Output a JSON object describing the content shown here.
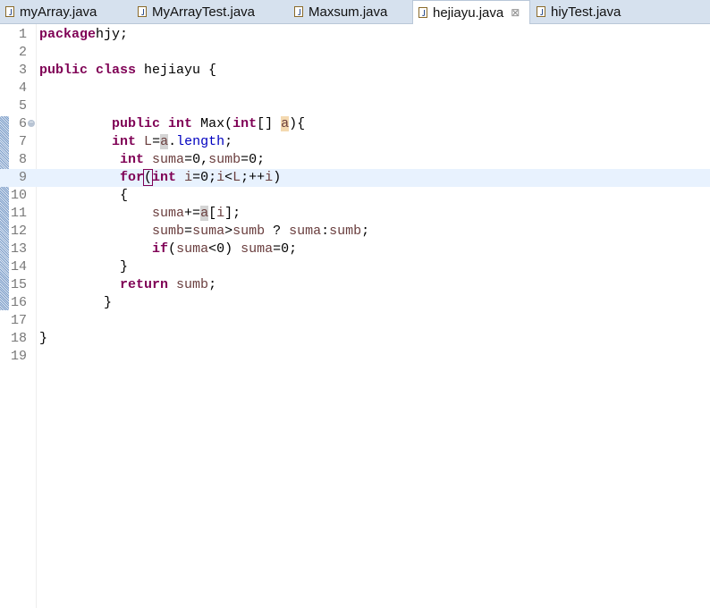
{
  "tabs": [
    {
      "label": "myArray.java",
      "active": false
    },
    {
      "label": "MyArrayTest.java",
      "active": false
    },
    {
      "label": "Maxsum.java",
      "active": false
    },
    {
      "label": "hejiayu.java",
      "active": true
    },
    {
      "label": "hiyTest.java",
      "active": false
    }
  ],
  "close_glyph": "⊠",
  "current_line": 9,
  "lines": [
    {
      "n": "1",
      "indent": 0,
      "t": [
        [
          "kw",
          "package"
        ],
        [
          "",
          "hjy;"
        ]
      ]
    },
    {
      "n": "2",
      "indent": 0,
      "t": []
    },
    {
      "n": "3",
      "indent": 0,
      "t": [
        [
          "kw",
          "public"
        ],
        [
          "",
          " "
        ],
        [
          "kw",
          "class"
        ],
        [
          "",
          " hejiayu {"
        ]
      ]
    },
    {
      "n": "4",
      "indent": 0,
      "t": []
    },
    {
      "n": "5",
      "indent": 0,
      "t": []
    },
    {
      "n": "6",
      "indent": 9,
      "fold": true,
      "t": [
        [
          "kw",
          "public"
        ],
        [
          "",
          " "
        ],
        [
          "kw",
          "int"
        ],
        [
          "",
          " Max("
        ],
        [
          "kw",
          "int"
        ],
        [
          "",
          "[] "
        ],
        [
          "var occw",
          "a"
        ],
        [
          "",
          "){"
        ]
      ]
    },
    {
      "n": "7",
      "indent": 9,
      "t": [
        [
          "kw",
          "int"
        ],
        [
          "",
          " "
        ],
        [
          "var",
          "L"
        ],
        [
          "",
          "="
        ],
        [
          "var occ",
          "a"
        ],
        [
          "",
          "."
        ],
        [
          "fld",
          "length"
        ],
        [
          "",
          ";"
        ]
      ]
    },
    {
      "n": "8",
      "indent": 10,
      "t": [
        [
          "kw",
          "int"
        ],
        [
          "",
          " "
        ],
        [
          "var",
          "suma"
        ],
        [
          "",
          "=0,"
        ],
        [
          "var",
          "sumb"
        ],
        [
          "",
          "=0;"
        ]
      ]
    },
    {
      "n": "9",
      "indent": 10,
      "t": [
        [
          "kw",
          "for"
        ],
        [
          "br",
          "("
        ],
        [
          "kw",
          "int"
        ],
        [
          "",
          " "
        ],
        [
          "var",
          "i"
        ],
        [
          "",
          "=0;"
        ],
        [
          "var",
          "i"
        ],
        [
          "",
          "<"
        ],
        [
          "var",
          "L"
        ],
        [
          "",
          ";++"
        ],
        [
          "var",
          "i"
        ],
        [
          "",
          ")"
        ]
      ]
    },
    {
      "n": "10",
      "indent": 10,
      "t": [
        [
          "",
          "{"
        ]
      ]
    },
    {
      "n": "11",
      "indent": 14,
      "t": [
        [
          "var",
          "suma"
        ],
        [
          "",
          "+="
        ],
        [
          "var occ",
          "a"
        ],
        [
          "",
          "["
        ],
        [
          "var",
          "i"
        ],
        [
          "",
          "];"
        ]
      ]
    },
    {
      "n": "12",
      "indent": 14,
      "t": [
        [
          "var",
          "sumb"
        ],
        [
          "",
          "="
        ],
        [
          "var",
          "suma"
        ],
        [
          "",
          ">"
        ],
        [
          "var",
          "sumb"
        ],
        [
          "",
          " ? "
        ],
        [
          "var",
          "suma"
        ],
        [
          "",
          ":"
        ],
        [
          "var",
          "sumb"
        ],
        [
          "",
          ";"
        ]
      ]
    },
    {
      "n": "13",
      "indent": 14,
      "t": [
        [
          "kw",
          "if"
        ],
        [
          "",
          "("
        ],
        [
          "var",
          "suma"
        ],
        [
          "",
          "<0) "
        ],
        [
          "var",
          "suma"
        ],
        [
          "",
          "=0;"
        ]
      ]
    },
    {
      "n": "14",
      "indent": 10,
      "t": [
        [
          "",
          "}"
        ]
      ]
    },
    {
      "n": "15",
      "indent": 10,
      "t": [
        [
          "kw",
          "return"
        ],
        [
          "",
          " "
        ],
        [
          "var",
          "sumb"
        ],
        [
          "",
          ";"
        ]
      ]
    },
    {
      "n": "16",
      "indent": 8,
      "t": [
        [
          "",
          "}"
        ]
      ]
    },
    {
      "n": "17",
      "indent": 0,
      "t": []
    },
    {
      "n": "18",
      "indent": 0,
      "t": [
        [
          "",
          "}"
        ]
      ]
    },
    {
      "n": "19",
      "indent": 0,
      "t": []
    }
  ]
}
